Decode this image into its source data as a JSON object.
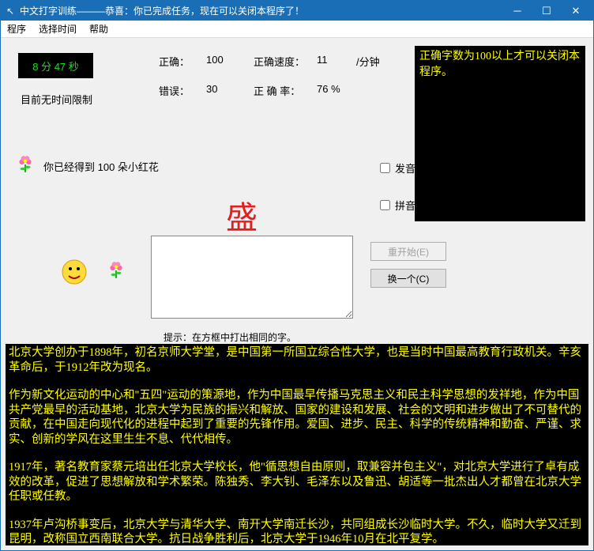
{
  "titlebar": {
    "icon": "↖",
    "text": "中文打字训练———恭喜：你已完成任务，现在可以关闭本程序了！"
  },
  "menu": {
    "program": "程序",
    "select_time": "选择时间",
    "help": "帮助"
  },
  "timer": "8 分 47 秒",
  "time_limit": "目前无时间限制",
  "stats": {
    "correct_label": "正确：",
    "correct_value": "100",
    "error_label": "错误：",
    "error_value": "30",
    "speed_label": "正确速度：",
    "speed_value": "11",
    "speed_unit": "/分钟",
    "rate_label": "正 确 率：",
    "rate_value": "76 %"
  },
  "reward_text": "你已经得到 100 朵小红花",
  "current_char": "盛",
  "checkboxes": {
    "sound": "发音",
    "pinyin": "拼音提示"
  },
  "buttons": {
    "restart": "重开始(E)",
    "next": "换一个(C)"
  },
  "side_message": "正确字数为100以上才可以关闭本程序。",
  "hint": "提示：在方框中打出相同的字。",
  "article": {
    "p1": "北京大学创办于1898年，初名京师大学堂，是中国第一所国立综合性大学，也是当时中国最高教育行政机关。辛亥革命后，于1912年改为现名。",
    "p2": "作为新文化运动的中心和\"五四\"运动的策源地，作为中国最早传播马克思主义和民主科学思想的发祥地，作为中国共产党最早的活动基地，北京大学为民族的振兴和解放、国家的建设和发展、社会的文明和进步做出了不可替代的贡献，在中国走向现代化的进程中起到了重要的先锋作用。爱国、进步、民主、科学的传统精神和勤奋、严谨、求实、创新的学风在这里生生不息、代代相传。",
    "p3": "1917年，著名教育家蔡元培出任北京大学校长，他\"循思想自由原则，取兼容并包主义\"，对北京大学进行了卓有成效的改革，促进了思想解放和学术繁荣。陈独秀、李大钊、毛泽东以及鲁迅、胡适等一批杰出人才都曾在北京大学任职或任教。",
    "p4": "1937年卢沟桥事变后，北京大学与清华大学、南开大学南迁长沙，共同组成长沙临时大学。不久，临时大学又迁到昆明，改称国立西南联合大学。抗日战争胜利后，北京大学于1946年10月在北平复学。"
  }
}
